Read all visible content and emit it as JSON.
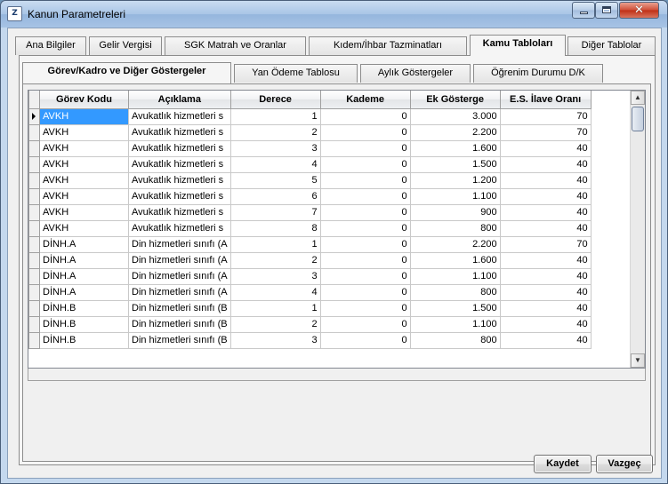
{
  "window": {
    "title": "Kanun Parametreleri",
    "icon_letter": "Z"
  },
  "top_tabs": [
    {
      "label": "Ana Bilgiler"
    },
    {
      "label": "Gelir Vergisi"
    },
    {
      "label": "SGK Matrah ve Oranlar"
    },
    {
      "label": "Kıdem/İhbar Tazminatları"
    },
    {
      "label": "Kamu Tabloları",
      "active": true
    },
    {
      "label": "Diğer Tablolar"
    }
  ],
  "inner_tabs": [
    {
      "label": "Görev/Kadro ve Diğer Göstergeler",
      "active": true
    },
    {
      "label": "Yan Ödeme Tablosu"
    },
    {
      "label": "Aylık Göstergeler"
    },
    {
      "label": "Öğrenim Durumu D/K"
    }
  ],
  "grid": {
    "columns": [
      "Görev Kodu",
      "Açıklama",
      "Derece",
      "Kademe",
      "Ek Gösterge",
      "E.S. İlave Oranı"
    ],
    "rows": [
      [
        "AVKH",
        "Avukatlık hizmetleri s",
        "1",
        "0",
        "3.000",
        "70"
      ],
      [
        "AVKH",
        "Avukatlık hizmetleri s",
        "2",
        "0",
        "2.200",
        "70"
      ],
      [
        "AVKH",
        "Avukatlık hizmetleri s",
        "3",
        "0",
        "1.600",
        "40"
      ],
      [
        "AVKH",
        "Avukatlık hizmetleri s",
        "4",
        "0",
        "1.500",
        "40"
      ],
      [
        "AVKH",
        "Avukatlık hizmetleri s",
        "5",
        "0",
        "1.200",
        "40"
      ],
      [
        "AVKH",
        "Avukatlık hizmetleri s",
        "6",
        "0",
        "1.100",
        "40"
      ],
      [
        "AVKH",
        "Avukatlık hizmetleri s",
        "7",
        "0",
        "900",
        "40"
      ],
      [
        "AVKH",
        "Avukatlık hizmetleri s",
        "8",
        "0",
        "800",
        "40"
      ],
      [
        "DİNH.A",
        "Din hizmetleri sınıfı (A",
        "1",
        "0",
        "2.200",
        "70"
      ],
      [
        "DİNH.A",
        "Din hizmetleri sınıfı (A",
        "2",
        "0",
        "1.600",
        "40"
      ],
      [
        "DİNH.A",
        "Din hizmetleri sınıfı (A",
        "3",
        "0",
        "1.100",
        "40"
      ],
      [
        "DİNH.A",
        "Din hizmetleri sınıfı (A",
        "4",
        "0",
        "800",
        "40"
      ],
      [
        "DİNH.B",
        "Din hizmetleri sınıfı (B",
        "1",
        "0",
        "1.500",
        "40"
      ],
      [
        "DİNH.B",
        "Din hizmetleri sınıfı (B",
        "2",
        "0",
        "1.100",
        "40"
      ],
      [
        "DİNH.B",
        "Din hizmetleri sınıfı (B",
        "3",
        "0",
        "800",
        "40"
      ]
    ]
  },
  "buttons": {
    "save": "Kaydet",
    "cancel": "Vazgeç"
  },
  "colors": {
    "selection": "#3399ff",
    "titlebar": "#a9c5e6"
  }
}
